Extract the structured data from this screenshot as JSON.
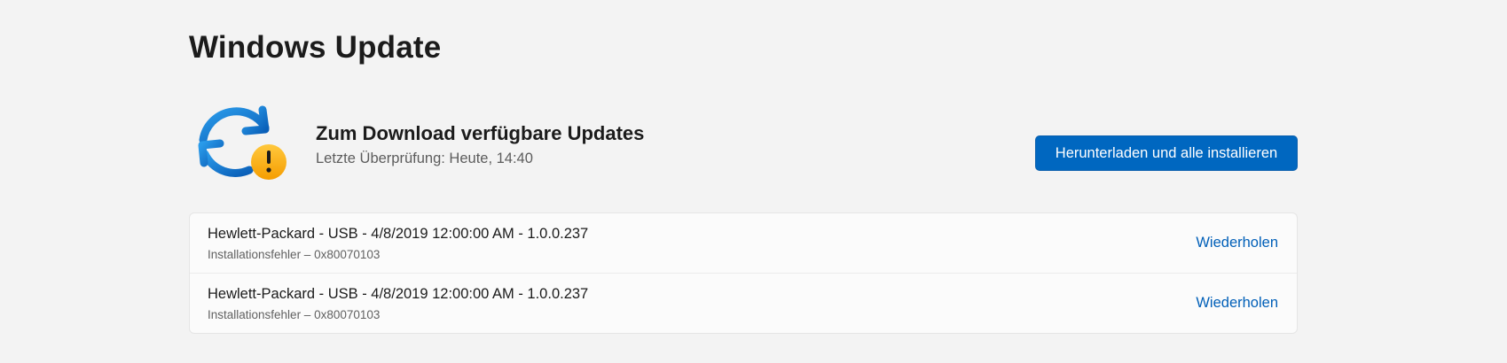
{
  "page": {
    "title": "Windows Update"
  },
  "status": {
    "icon": "sync-warning-icon",
    "title": "Zum Download verfügbare Updates",
    "subtitle": "Letzte Überprüfung: Heute, 14:40",
    "action_label": "Herunterladen und alle installieren"
  },
  "updates": [
    {
      "name": "Hewlett-Packard - USB - 4/8/2019 12:00:00 AM - 1.0.0.237",
      "status": "Installationsfehler – 0x80070103",
      "action_label": "Wiederholen"
    },
    {
      "name": "Hewlett-Packard - USB - 4/8/2019 12:00:00 AM - 1.0.0.237",
      "status": "Installationsfehler – 0x80070103",
      "action_label": "Wiederholen"
    }
  ],
  "colors": {
    "background": "#f3f3f3",
    "accent": "#0067c0",
    "link": "#005fb8",
    "warning": "#f7a500",
    "sync_icon": "#1a86d9"
  }
}
